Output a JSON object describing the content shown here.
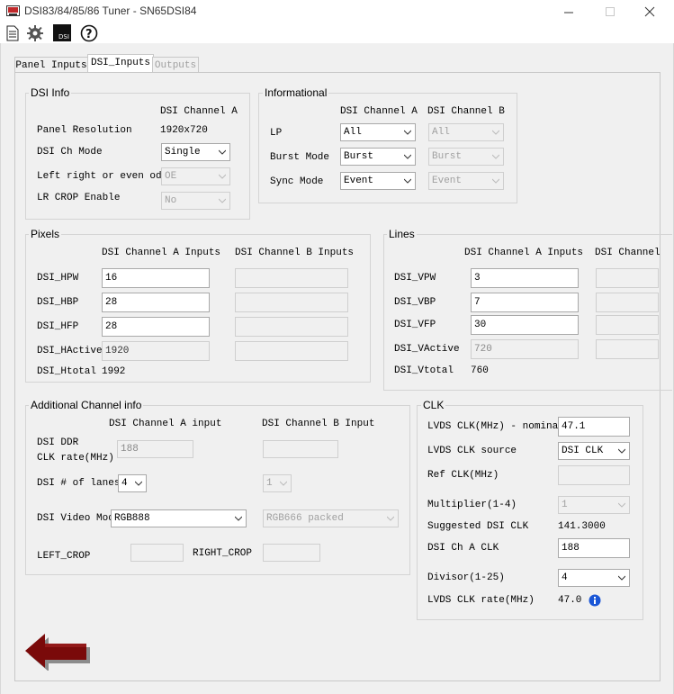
{
  "window": {
    "title": "DSI83/84/85/86 Tuner - SN65DSI84"
  },
  "tabs": [
    {
      "label": "Panel Inputs"
    },
    {
      "label": "DSI_Inputs"
    },
    {
      "label": "Outputs"
    }
  ],
  "dsi_info": {
    "title": "DSI Info",
    "col_header": "DSI Channel A",
    "panel_resolution_label": "Panel Resolution",
    "panel_resolution_value": "1920x720",
    "ch_mode_label": "DSI Ch Mode",
    "ch_mode_value": "Single",
    "lr_label": "Left right or even odd",
    "lr_value": "OE",
    "lr_crop_label": "LR CROP Enable",
    "lr_crop_value": "No"
  },
  "informational": {
    "title": "Informational",
    "col_a": "DSI Channel A",
    "col_b": "DSI Channel B",
    "lp_label": "LP",
    "lp_a": "All",
    "lp_b": "All",
    "burst_label": "Burst Mode",
    "burst_a": "Burst",
    "burst_b": "Burst",
    "sync_label": "Sync Mode",
    "sync_a": "Event",
    "sync_b": "Event"
  },
  "pixels": {
    "title": "Pixels",
    "col_a": "DSI Channel A Inputs",
    "col_b": "DSI Channel B Inputs",
    "hpw_label": "DSI_HPW",
    "hpw_a": "16",
    "hbp_label": "DSI_HBP",
    "hbp_a": "28",
    "hfp_label": "DSI_HFP",
    "hfp_a": "28",
    "hactive_label": "DSI_HActive",
    "hactive_a": "1920",
    "htotal_label": "DSI_Htotal",
    "htotal_a": "1992"
  },
  "lines": {
    "title": "Lines",
    "col_a": "DSI Channel A Inputs",
    "col_b": "DSI Channel",
    "vpw_label": "DSI_VPW",
    "vpw_a": "3",
    "vbp_label": "DSI_VBP",
    "vbp_a": "7",
    "vfp_label": "DSI_VFP",
    "vfp_a": "30",
    "vactive_label": "DSI_VActive",
    "vactive_a": "720",
    "vtotal_label": "DSI_Vtotal",
    "vtotal_a": "760"
  },
  "additional": {
    "title": "Additional Channel info",
    "col_a": "DSI Channel A input",
    "col_b": "DSI Channel B Input",
    "ddr_label_1": "DSI DDR",
    "ddr_label_2": "CLK rate(MHz)",
    "ddr_a": "188",
    "lanes_label": "DSI # of lanes",
    "lanes_a": "4",
    "lanes_b": "1",
    "video_mode_label": "DSI Video Mode",
    "video_mode_a": "RGB888",
    "video_mode_b": "RGB666 packed",
    "left_crop_label": "LEFT_CROP",
    "right_crop_label": "RIGHT_CROP"
  },
  "clk": {
    "title": "CLK",
    "lvds_nominal_label": "LVDS CLK(MHz) - nominal",
    "lvds_nominal_value": "47.1",
    "lvds_source_label": "LVDS CLK source",
    "lvds_source_value": "DSI CLK",
    "ref_clk_label": "Ref CLK(MHz)",
    "multiplier_label": "Multiplier(1-4)",
    "multiplier_value": "1",
    "suggested_label": "Suggested DSI CLK",
    "suggested_value": "141.3000",
    "dsi_a_clk_label": "DSI Ch A CLK",
    "dsi_a_clk_value": "188",
    "divisor_label": "Divisor(1-25)",
    "divisor_value": "4",
    "lvds_rate_label": "LVDS CLK rate(MHz)",
    "lvds_rate_value": "47.0"
  },
  "colors": {
    "back_arrow": "#7a0a0a",
    "info_icon": "#1a56d6",
    "app_icon": "#c0282a"
  },
  "icons": [
    "app-icon",
    "document-icon",
    "gear-icon",
    "dsi-icon",
    "help-icon",
    "info-icon",
    "back-arrow-icon"
  ]
}
